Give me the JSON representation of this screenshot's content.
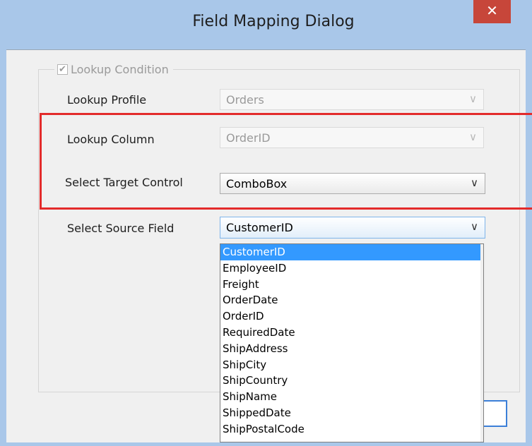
{
  "window": {
    "title": "Field Mapping Dialog",
    "close_label": "✕"
  },
  "group": {
    "checkbox_checked": true,
    "checkbox_mark": "✔",
    "label": "Lookup Condition"
  },
  "fields": {
    "lookup_profile": {
      "label": "Lookup Profile",
      "value": "Orders"
    },
    "lookup_column": {
      "label": "Lookup Column",
      "value": "OrderID"
    },
    "target_control": {
      "label": "Select Target Control",
      "value": "ComboBox"
    },
    "source_field": {
      "label": "Select Source Field",
      "value": "CustomerID"
    }
  },
  "chevron": "∨",
  "dropdown": {
    "selected_index": 0,
    "options": [
      "CustomerID",
      "EmployeeID",
      "Freight",
      "OrderDate",
      "OrderID",
      "RequiredDate",
      "ShipAddress",
      "ShipCity",
      "ShipCountry",
      "ShipName",
      "ShippedDate",
      "ShipPostalCode"
    ]
  },
  "colors": {
    "title_bar": "#a9c7e9",
    "close_button": "#c7463a",
    "highlight_outline": "#e32b2b",
    "selection": "#3399ff"
  }
}
